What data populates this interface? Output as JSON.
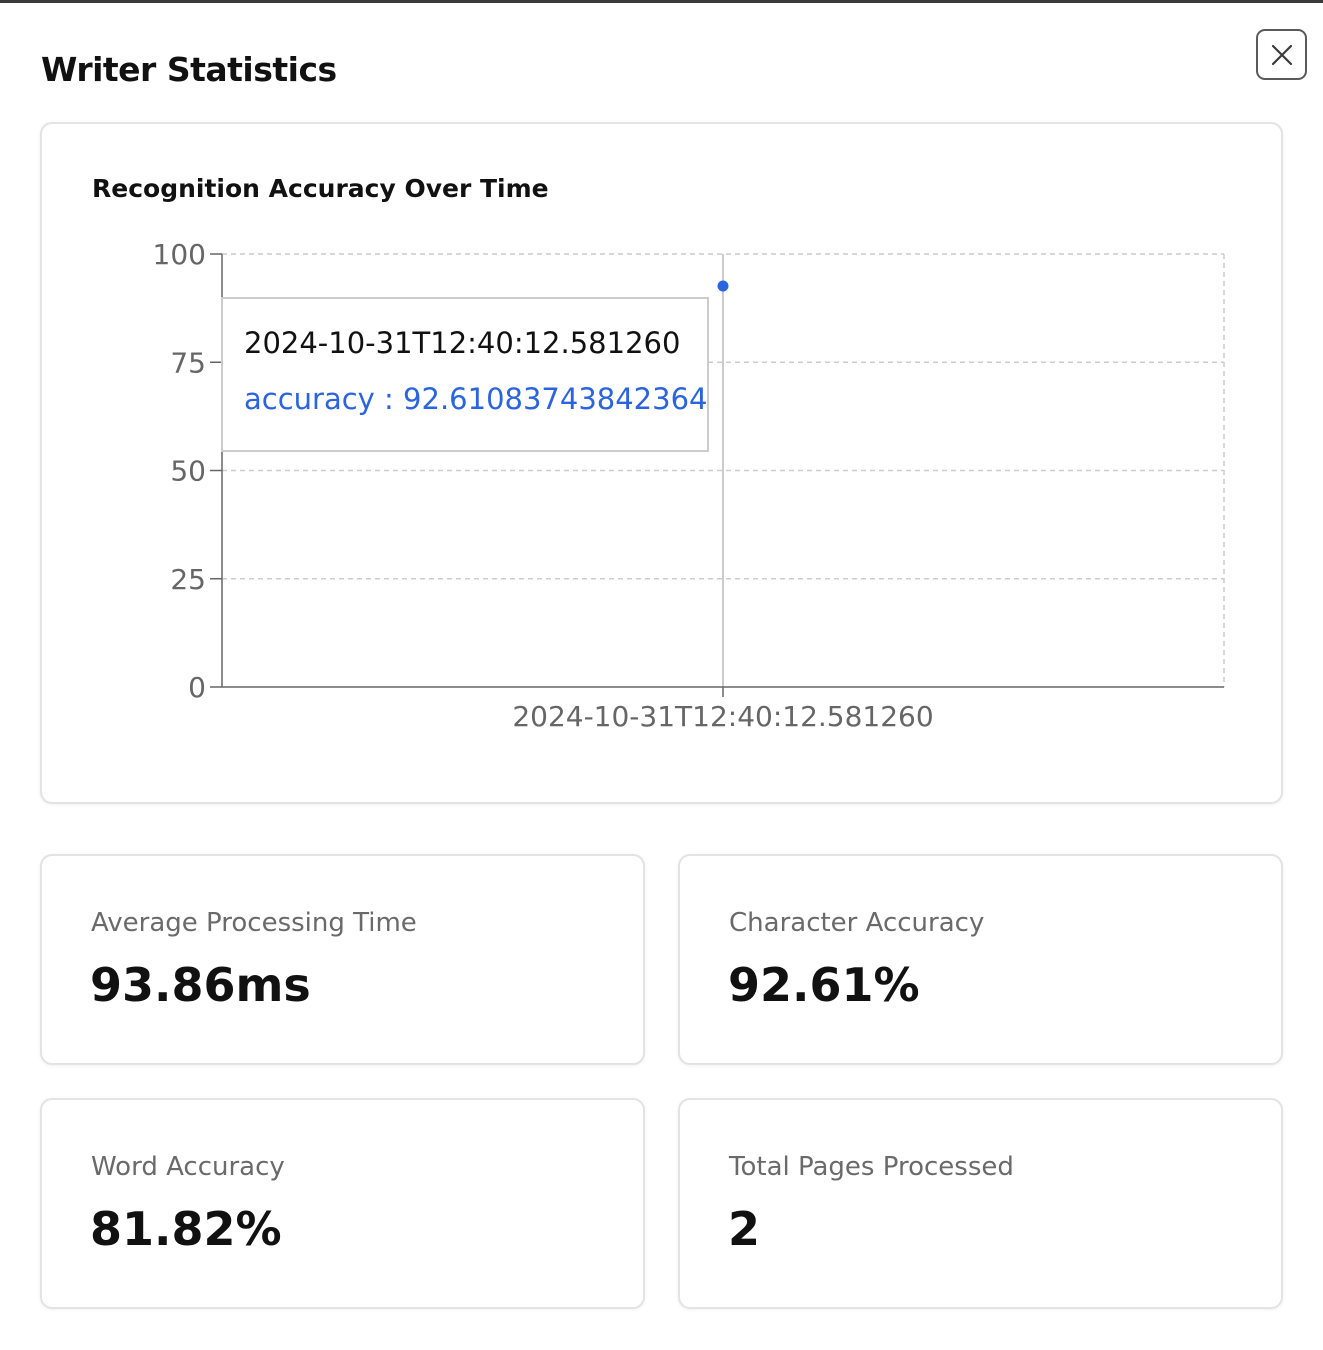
{
  "modal": {
    "title": "Writer Statistics",
    "close_icon": "close-icon"
  },
  "chart_card": {
    "title": "Recognition Accuracy Over Time",
    "tooltip": {
      "label": "2024-10-31T12:40:12.581260",
      "item": "accuracy : 92.61083743842364"
    }
  },
  "chart_data": {
    "type": "line",
    "title": "Recognition Accuracy Over Time",
    "x": [
      "2024-10-31T12:40:12.581260"
    ],
    "series": [
      {
        "name": "accuracy",
        "values": [
          92.61083743842364
        ]
      }
    ],
    "xlabel": "",
    "ylabel": "",
    "ylim": [
      0,
      100
    ],
    "yticks": [
      "0",
      "25",
      "50",
      "75",
      "100"
    ],
    "grid": true,
    "series_color": "#2a64e0"
  },
  "stats": [
    {
      "label": "Average Processing Time",
      "value": "93.86ms"
    },
    {
      "label": "Character Accuracy",
      "value": "92.61%"
    },
    {
      "label": "Word Accuracy",
      "value": "81.82%"
    },
    {
      "label": "Total Pages Processed",
      "value": "2"
    }
  ]
}
